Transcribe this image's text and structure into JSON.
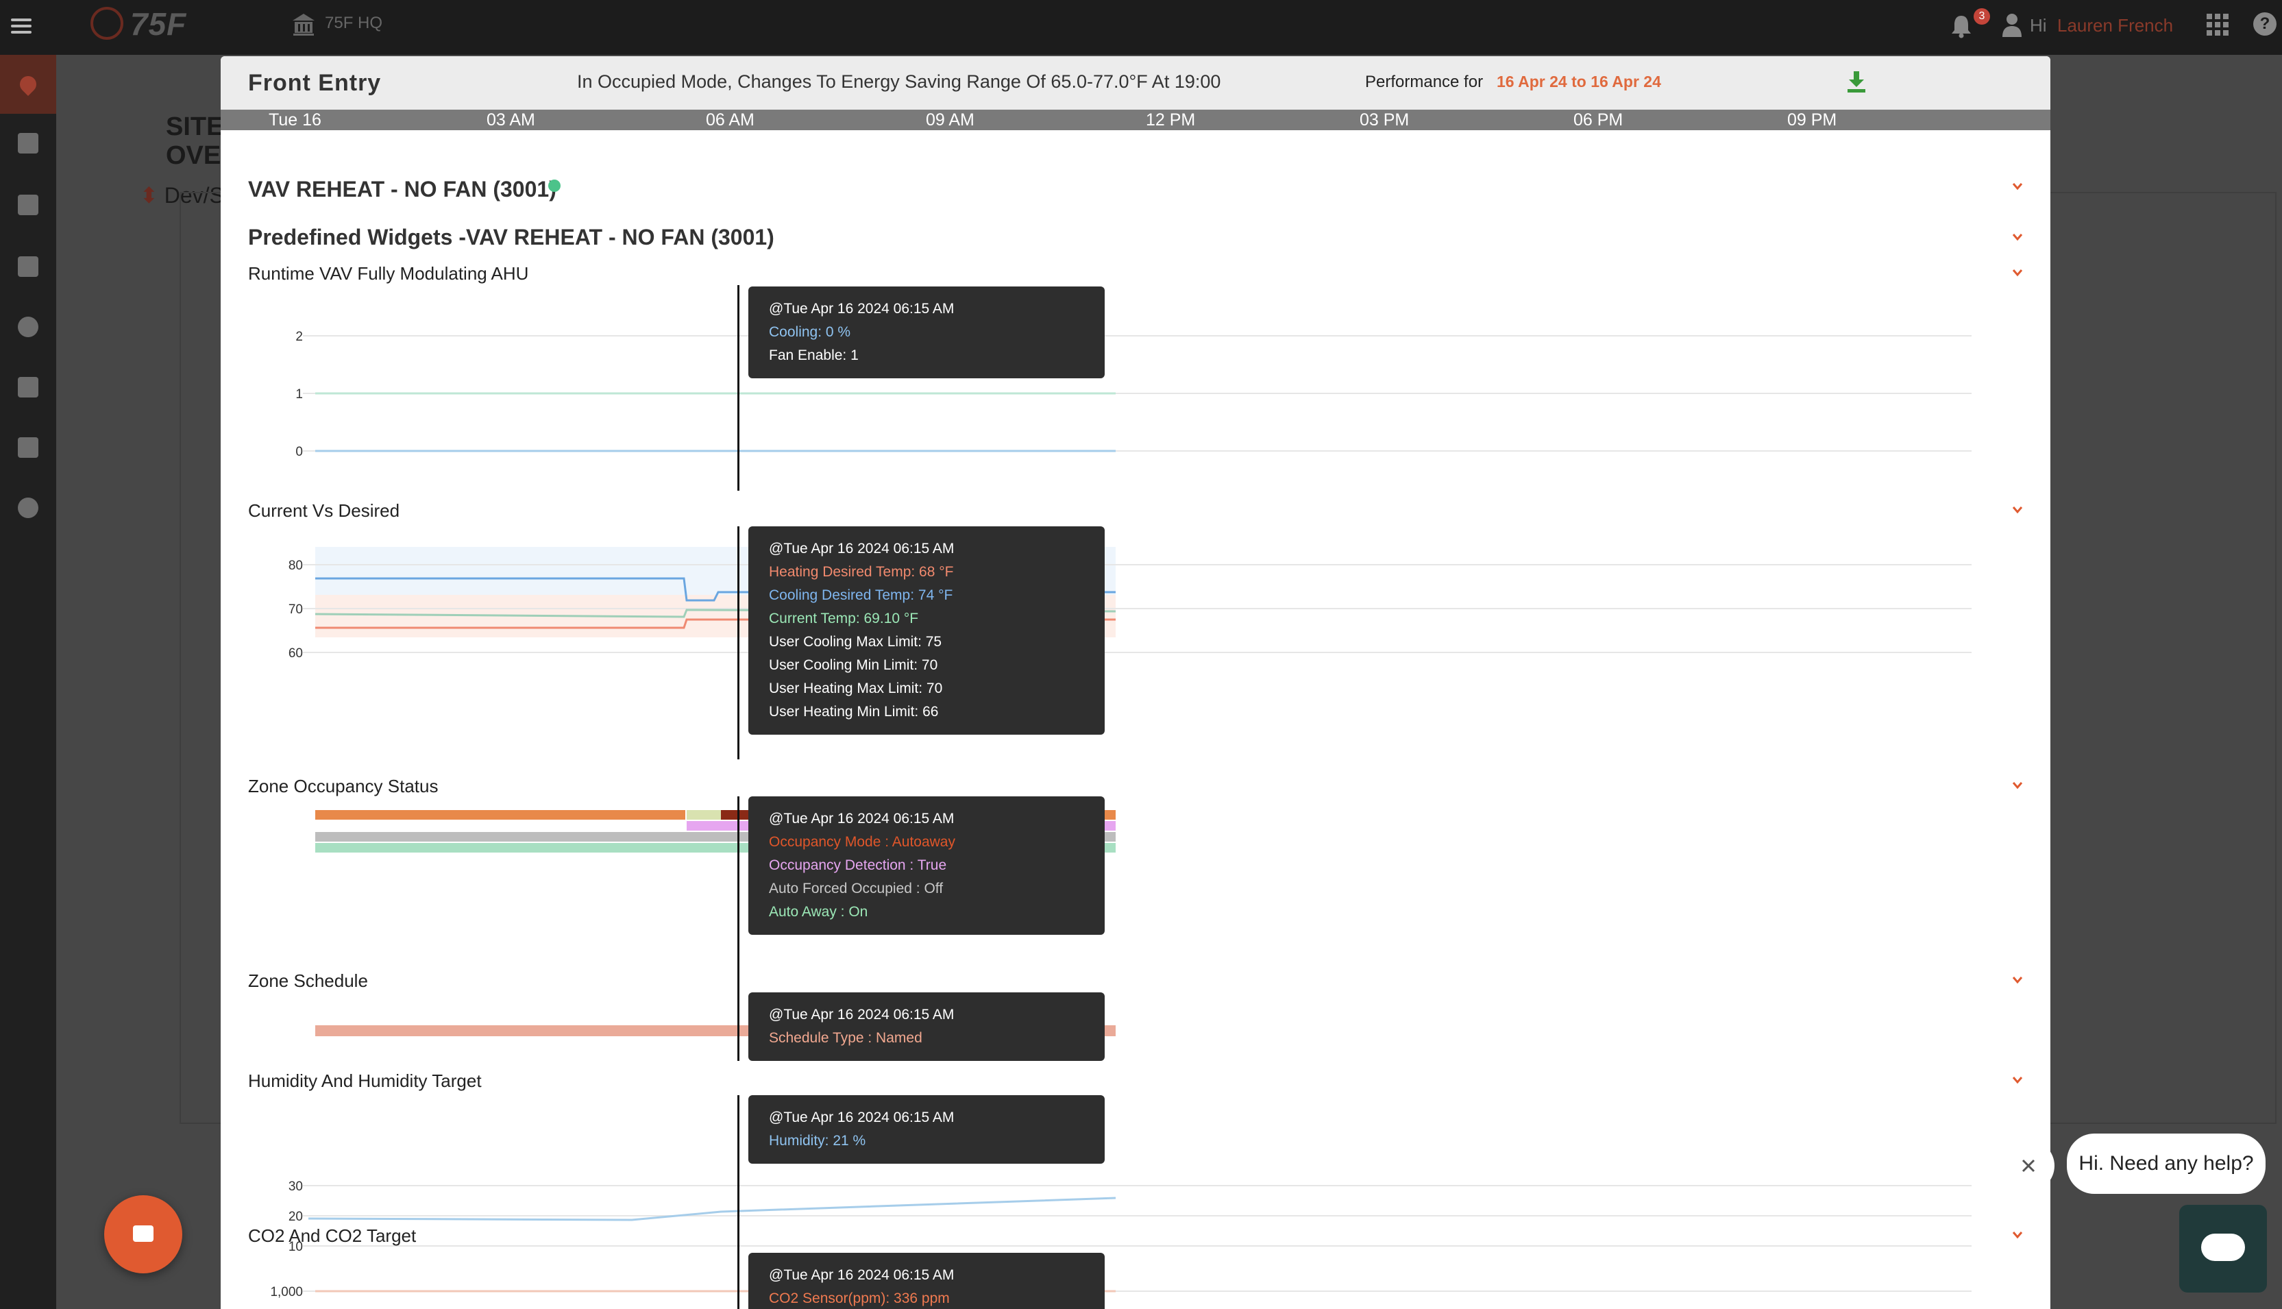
{
  "topbar": {
    "logo_text": "75F",
    "site_name": "75F HQ",
    "notification_count": "3",
    "greeting": "Hi",
    "user_name": "Lauren French"
  },
  "background": {
    "page_title_line1": "SITE",
    "page_title_line2": "OVERVIE",
    "breadcrumb": "Dev/Supp"
  },
  "modal": {
    "title": "Front Entry",
    "mode_text": "In Occupied Mode, Changes To Energy Saving Range Of 65.0-77.0°F At 19:00",
    "performance_label": "Performance for",
    "performance_range": "16 Apr 24 to 16 Apr 24",
    "timeline_ticks": [
      "Tue 16",
      "03 AM",
      "06 AM",
      "09 AM",
      "12 PM",
      "03 PM",
      "06 PM",
      "09 PM"
    ],
    "section_title": "VAV REHEAT - NO FAN (3001)",
    "predefined_title": "Predefined Widgets -VAV REHEAT - NO FAN (3001)",
    "widgets": [
      {
        "title": "Runtime VAV Fully Modulating AHU",
        "y_ticks": [
          "2",
          "1",
          "0"
        ],
        "tooltip": {
          "head": "@Tue Apr 16 2024 06:15 AM",
          "lines": [
            {
              "text": "Cooling: 0 %",
              "color": "#8fc3f0"
            },
            {
              "text": "Fan Enable: 1",
              "color": "#ffffff"
            }
          ]
        }
      },
      {
        "title": "Current Vs Desired",
        "y_ticks": [
          "80",
          "70",
          "60"
        ],
        "tooltip": {
          "head": "@Tue Apr 16 2024 06:15 AM",
          "lines": [
            {
              "text": "Heating Desired Temp: 68 °F",
              "color": "#f28a6e"
            },
            {
              "text": "Cooling Desired Temp: 74 °F",
              "color": "#7fb6ef"
            },
            {
              "text": "Current Temp: 69.10 °F",
              "color": "#9be7b6"
            },
            {
              "text": "User Cooling Max Limit: 75",
              "color": "#ffffff"
            },
            {
              "text": "User Cooling Min Limit: 70",
              "color": "#ffffff"
            },
            {
              "text": "User Heating Max Limit: 70",
              "color": "#ffffff"
            },
            {
              "text": "User Heating Min Limit: 66",
              "color": "#ffffff"
            }
          ]
        }
      },
      {
        "title": "Zone Occupancy Status",
        "tooltip": {
          "head": "@Tue Apr 16 2024 06:15 AM",
          "lines": [
            {
              "text": "Occupancy Mode : Autoaway",
              "color": "#e0562a"
            },
            {
              "text": "Occupancy Detection : True",
              "color": "#e6a6f0"
            },
            {
              "text": "Auto Forced Occupied : Off",
              "color": "#c8c8c8"
            },
            {
              "text": "Auto Away : On",
              "color": "#9be7b6"
            }
          ]
        }
      },
      {
        "title": "Zone Schedule",
        "tooltip": {
          "head": "@Tue Apr 16 2024 06:15 AM",
          "lines": [
            {
              "text": "Schedule Type : Named",
              "color": "#f2a890"
            }
          ]
        }
      },
      {
        "title": "Humidity And Humidity Target",
        "y_ticks": [
          "30",
          "20",
          "10"
        ],
        "tooltip": {
          "head": "@Tue Apr 16 2024 06:15 AM",
          "lines": [
            {
              "text": "Humidity: 21 %",
              "color": "#8fc3f0"
            }
          ]
        }
      },
      {
        "title": "CO2 And CO2 Target",
        "y_ticks": [
          "1,000"
        ],
        "tooltip": {
          "head": "@Tue Apr 16 2024 06:15 AM",
          "lines": [
            {
              "text": "CO2 Sensor(ppm): 336 ppm",
              "color": "#f07a50"
            }
          ]
        }
      }
    ]
  },
  "help": {
    "bubble_text": "Hi. Need any help?"
  },
  "colors": {
    "accent": "#e06a3e",
    "online": "#4cc38a",
    "download": "#3a9a3a"
  }
}
